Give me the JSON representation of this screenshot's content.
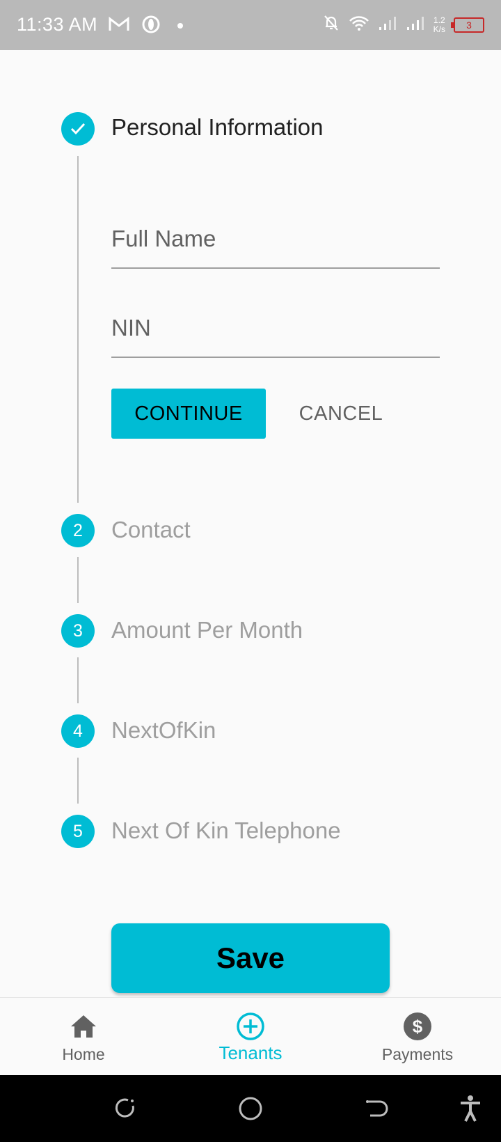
{
  "status_bar": {
    "time": "11:33 AM",
    "net_speed_value": "1.2",
    "net_speed_unit": "K/s",
    "battery_level": "3",
    "icons": [
      "gmail-icon",
      "opera-icon",
      "dot-icon",
      "bell-off-icon",
      "wifi-icon",
      "signal-icon",
      "signal-icon",
      "battery-icon"
    ]
  },
  "stepper": {
    "steps": [
      {
        "number": "1",
        "title": "Personal Information",
        "state": "completed"
      },
      {
        "number": "2",
        "title": "Contact",
        "state": "inactive"
      },
      {
        "number": "3",
        "title": "Amount Per Month",
        "state": "inactive"
      },
      {
        "number": "4",
        "title": "NextOfKin",
        "state": "inactive"
      },
      {
        "number": "5",
        "title": "Next Of Kin Telephone",
        "state": "inactive"
      }
    ],
    "form": {
      "full_name_placeholder": "Full Name",
      "nin_placeholder": "NIN",
      "continue_label": "CONTINUE",
      "cancel_label": "CANCEL"
    }
  },
  "save_label": "Save",
  "bottom_nav": {
    "items": [
      {
        "label": "Home",
        "icon": "home-icon",
        "active": false
      },
      {
        "label": "Tenants",
        "icon": "add-circle-icon",
        "active": true
      },
      {
        "label": "Payments",
        "icon": "dollar-circle-icon",
        "active": false
      }
    ]
  },
  "colors": {
    "accent": "#00bcd4",
    "status_bar": "#b9b9b9",
    "background": "#fafafa"
  }
}
